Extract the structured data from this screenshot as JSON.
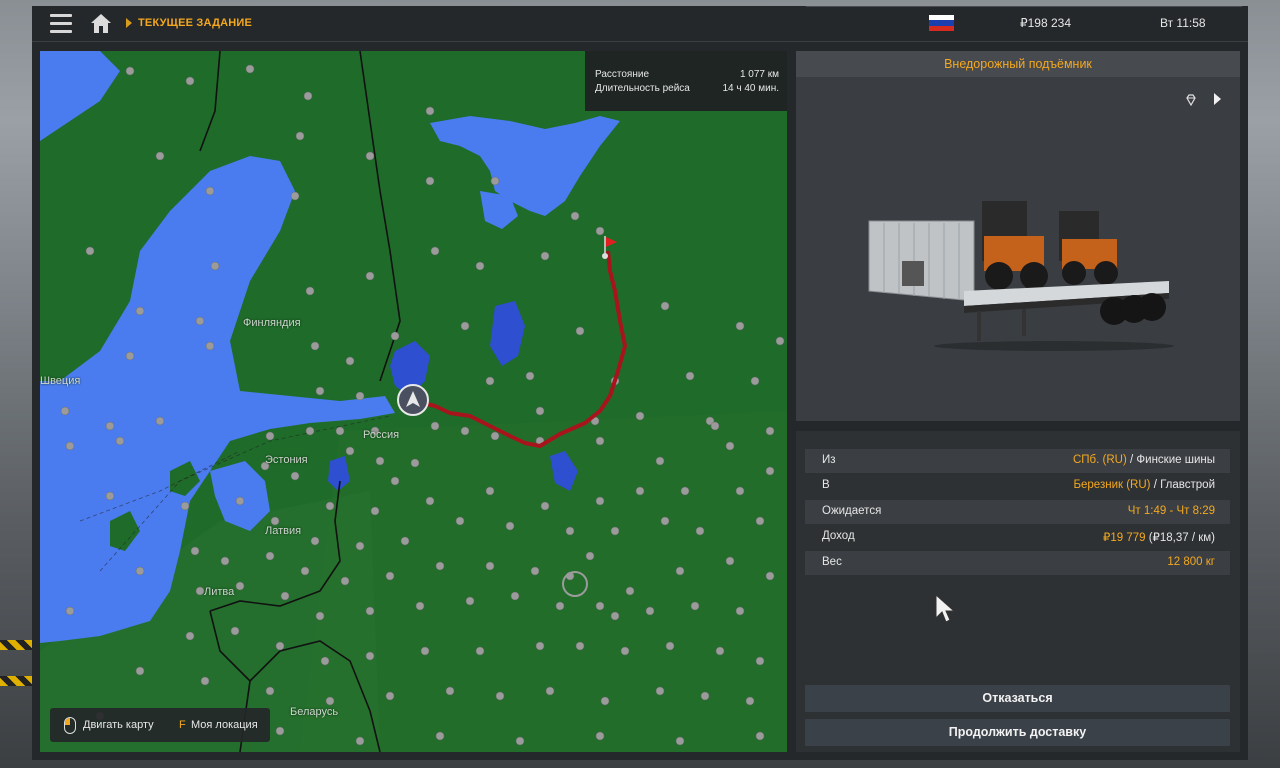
{
  "topbar": {
    "breadcrumb": "ТЕКУЩЕЕ ЗАДАНИЕ",
    "money": "₽198 234",
    "clock": "Вт 11:58",
    "icons": [
      "menu-icon",
      "home-icon",
      "russia-flag-icon"
    ],
    "flag_colors": [
      "#ffffff",
      "#1c3fb0",
      "#d52b1e"
    ]
  },
  "map": {
    "info": {
      "distance_label": "Расстояние",
      "distance_value": "1 077 км",
      "duration_label": "Длительность рейса",
      "duration_value": "14 ч 40 мин."
    },
    "labels": {
      "finland": "Финляндия",
      "sweden": "Швеция",
      "russia": "Россия",
      "estonia": "Эстония",
      "latvia": "Латвия",
      "lithuania": "Литва",
      "belarus": "Беларусь"
    },
    "controls": {
      "move_label": "Двигать карту",
      "location_key": "F",
      "location_label": "Моя локация"
    },
    "colors": {
      "land": "#1f6b2a",
      "water": "#4a7cf0",
      "route": "#a8141b"
    }
  },
  "cargo": {
    "title": "Внедорожный подъёмник"
  },
  "details": {
    "from_label": "Из",
    "from_city": "СПб. (RU)",
    "from_sep": " / ",
    "from_company": "Финские шины",
    "to_label": "В",
    "to_city": "Березник (RU)",
    "to_sep": " / ",
    "to_company": "Главстрой",
    "expected_label": "Ожидается",
    "expected_value": "Чт 1:49 - Чт 8:29",
    "income_label": "Доход",
    "income_value": "₽19 779",
    "income_rate": " (₽18,37 / км)",
    "weight_label": "Вес",
    "weight_value": "12 800 кг"
  },
  "actions": {
    "decline": "Отказаться",
    "continue": "Продолжить доставку"
  },
  "accent_color": "#f3a81f"
}
